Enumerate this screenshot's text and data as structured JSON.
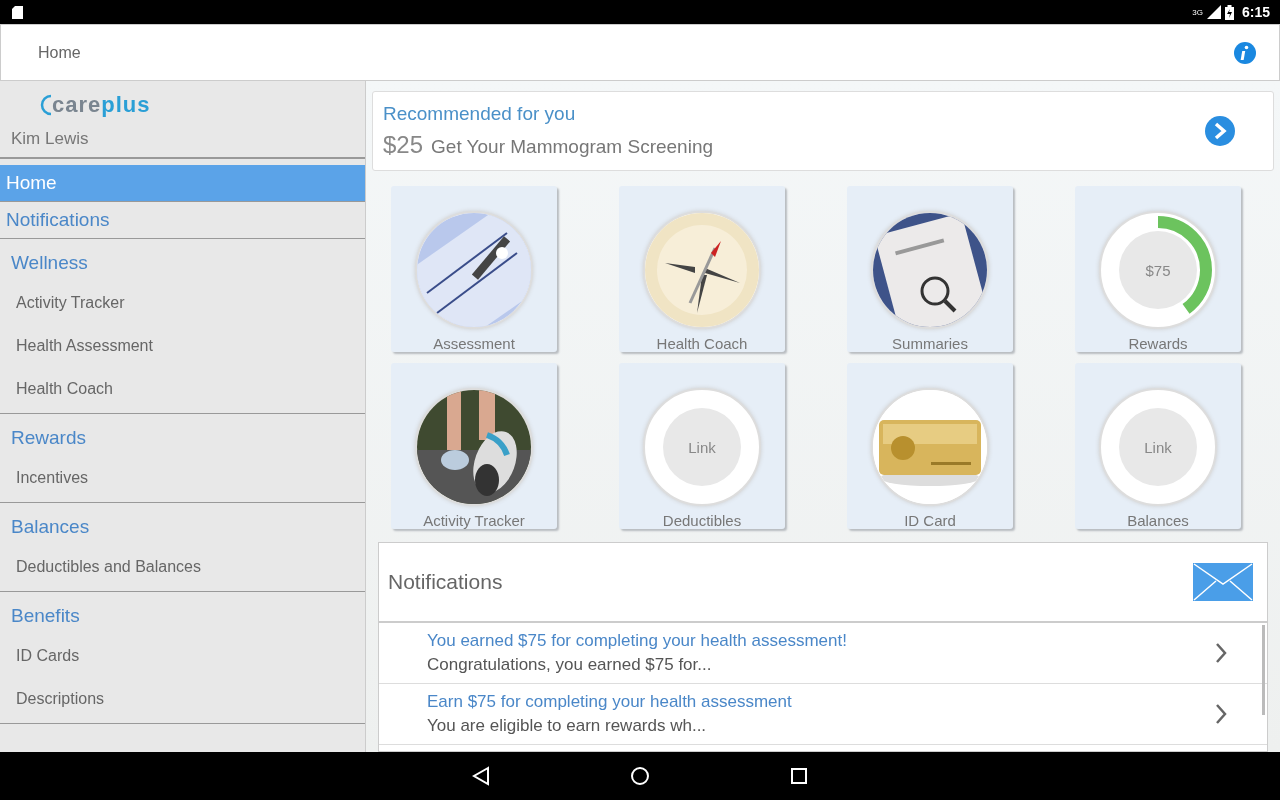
{
  "status_bar": {
    "network": "3G",
    "time": "6:15"
  },
  "header": {
    "title": "Home"
  },
  "sidebar": {
    "logo": [
      "care",
      "plus"
    ],
    "user": "Kim Lewis",
    "items": [
      {
        "label": "Home",
        "selected": true
      },
      {
        "label": "Notifications",
        "selected": false
      }
    ],
    "sections": [
      {
        "label": "Wellness",
        "children": [
          {
            "label": "Activity Tracker"
          },
          {
            "label": "Health Assessment"
          },
          {
            "label": "Health Coach"
          }
        ]
      },
      {
        "label": "Rewards",
        "children": [
          {
            "label": "Incentives"
          }
        ]
      },
      {
        "label": "Balances",
        "children": [
          {
            "label": "Deductibles and Balances"
          }
        ]
      },
      {
        "label": "Benefits",
        "children": [
          {
            "label": "ID Cards"
          },
          {
            "label": "Descriptions"
          }
        ]
      }
    ]
  },
  "recommended": {
    "title": "Recommended for you",
    "amount": "$25",
    "text": "Get Your Mammogram Screening"
  },
  "tiles": [
    {
      "label": "Assessment",
      "kind": "picture"
    },
    {
      "label": "Health Coach",
      "kind": "picture"
    },
    {
      "label": "Summaries",
      "kind": "picture"
    },
    {
      "label": "Rewards",
      "kind": "ring",
      "center": "$75",
      "level": 0.4
    },
    {
      "label": "Activity Tracker",
      "kind": "picture"
    },
    {
      "label": "Deductibles",
      "kind": "link",
      "center": "Link"
    },
    {
      "label": "ID Card",
      "kind": "picture"
    },
    {
      "label": "Balances",
      "kind": "link",
      "center": "Link"
    }
  ],
  "notifications": {
    "title": "Notifications",
    "items": [
      {
        "title": "You earned $75 for completing your health assessment!",
        "body": "Congratulations, you earned $75 for..."
      },
      {
        "title": "Earn $75 for completing your health assessment",
        "body": "You are eligible to earn rewards wh..."
      }
    ]
  }
}
